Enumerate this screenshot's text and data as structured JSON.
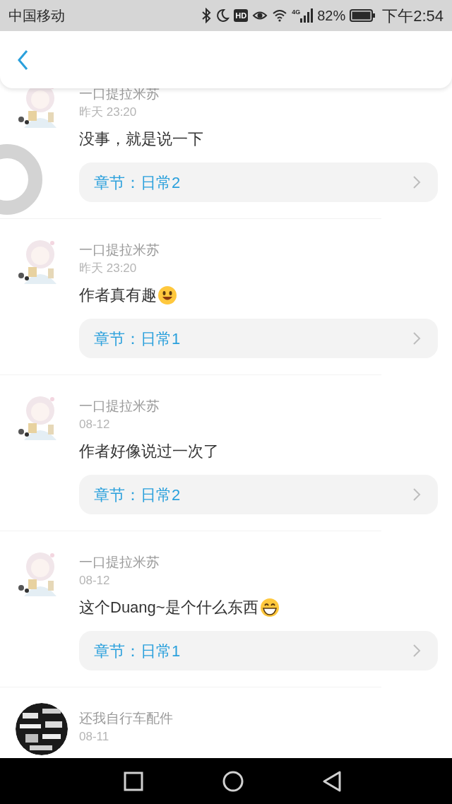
{
  "status_bar": {
    "carrier": "中国移动",
    "hd": "HD",
    "network": "4G",
    "battery": "82%",
    "time": "下午2:54"
  },
  "comments": [
    {
      "user": "一口提拉米苏",
      "avatar": {
        "kind": "picture"
      },
      "time": "昨天 23:20",
      "content": [
        {
          "kind": "text",
          "text": "没事，就是说一下"
        }
      ],
      "chapter": "章节：日常2"
    },
    {
      "user": "一口提拉米苏",
      "avatar": {
        "kind": "picture"
      },
      "time": "昨天 23:20",
      "content": [
        {
          "kind": "text",
          "text": "作者真有趣"
        },
        {
          "kind": "smile"
        }
      ],
      "chapter": "章节：日常1"
    },
    {
      "user": "一口提拉米苏",
      "avatar": {
        "kind": "picture"
      },
      "time": "08-12",
      "content": [
        {
          "kind": "text",
          "text": "作者好像说过一次了"
        }
      ],
      "chapter": "章节：日常2"
    },
    {
      "user": "一口提拉米苏",
      "avatar": {
        "kind": "picture"
      },
      "time": "08-12",
      "content": [
        {
          "kind": "text",
          "text": "这个Duang~是个什么东西"
        },
        {
          "kind": "grin"
        }
      ],
      "chapter": "章节：日常1"
    },
    {
      "user": "还我自行车配件",
      "avatar": {
        "kind": "picture"
      },
      "time": "08-11"
    }
  ]
}
